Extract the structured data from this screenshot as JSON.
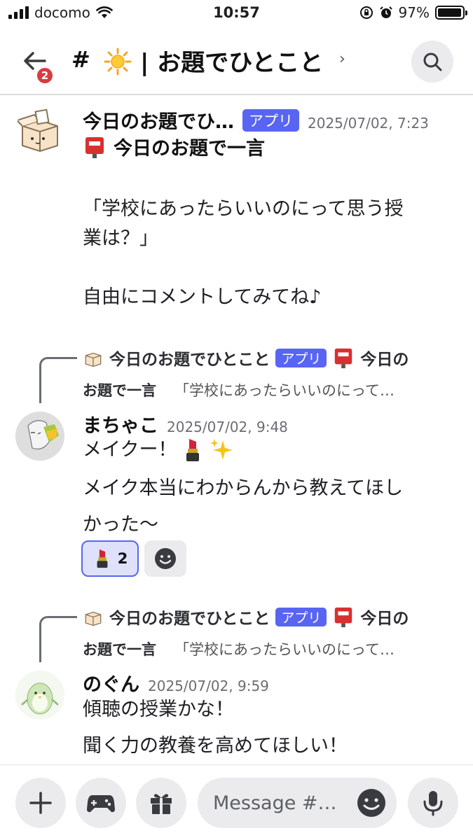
{
  "status_bar": {
    "carrier": "docomo",
    "time": "10:57",
    "battery_percent": "97%",
    "battery_level": 0.97
  },
  "header": {
    "back_badge": "2",
    "hash": "#",
    "channel_icon": "sun-icon",
    "channel_name": "| お題でひとこと",
    "chevron": "›"
  },
  "messages": [
    {
      "author": "今日のお題でひ…",
      "tag": "アプリ",
      "timestamp": "2025/07/02, 7:23",
      "title_icon": "postbox-icon",
      "title": "今日のお題で一言",
      "body": "「学校にあったらいいのにって思う授\n業は？」\n\n自由にコメントしてみてね♪"
    },
    {
      "reply": {
        "author": "今日のお題でひとこと",
        "tag": "アプリ",
        "title_start": "今日の",
        "title_end": "お題で一言",
        "excerpt": "「学校にあったらいいのにって…"
      },
      "author": "まちゃこ",
      "timestamp": "2025/07/02, 9:48",
      "line1": "メイクー！",
      "body": "メイク本当にわからんから教えてほし\nかった〜",
      "reaction_count": "2"
    },
    {
      "reply": {
        "author": "今日のお題でひとこと",
        "tag": "アプリ",
        "title_start": "今日の",
        "title_end": "お題で一言",
        "excerpt": "「学校にあったらいいのにって…"
      },
      "author": "のぐん",
      "timestamp": "2025/07/02, 9:59",
      "body": "傾聴の授業かな！\n聞く力の教養を高めてほしい！"
    }
  ],
  "composer": {
    "placeholder": "Message #…"
  },
  "colors": {
    "accent": "#5865f2",
    "badge": "#d83c3e",
    "button_bg": "#ebebed"
  }
}
